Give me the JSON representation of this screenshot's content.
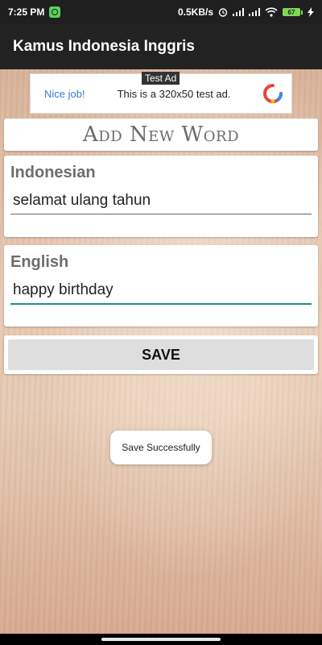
{
  "status_bar": {
    "time": "7:25 PM",
    "speed": "0.5KB/s",
    "battery": "67",
    "icons": [
      "app-notification-icon",
      "alarm-icon",
      "signal-icon",
      "signal-icon",
      "wifi-icon",
      "battery-icon",
      "charging-icon"
    ]
  },
  "app_bar": {
    "title": "Kamus Indonesia Inggris"
  },
  "ad": {
    "tag": "Test Ad",
    "headline": "Nice job!",
    "text": "This is a 320x50 test ad.",
    "logo": "admob-icon"
  },
  "form": {
    "title": "Add New Word",
    "indonesian_label": "Indonesian",
    "indonesian_value": "selamat ulang tahun",
    "english_label": "English",
    "english_value": "happy birthday",
    "save_label": "SAVE"
  },
  "toast": {
    "message": "Save Successfully"
  },
  "colors": {
    "app_bar": "#222222",
    "accent": "#1f8f8a",
    "button": "#dedede"
  }
}
